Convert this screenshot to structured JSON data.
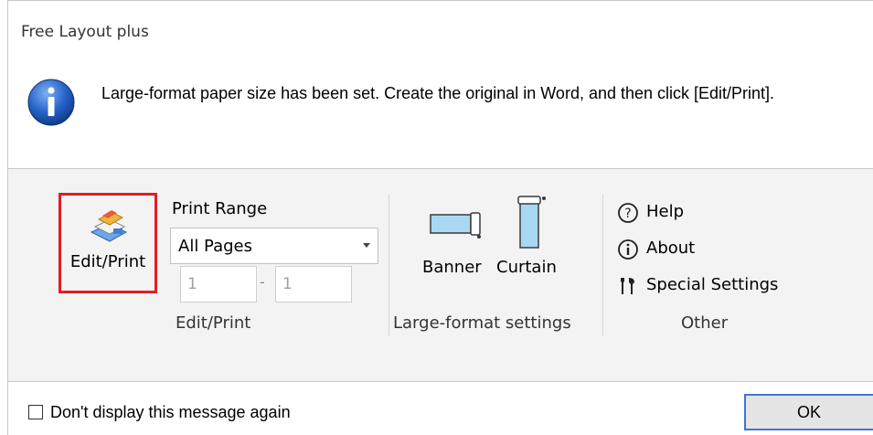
{
  "window": {
    "title": "Free Layout plus"
  },
  "message": {
    "text": "Large-format paper size has been set. Create the original in Word, and then click [Edit/Print]."
  },
  "ribbon": {
    "edit_print": {
      "button_label": "Edit/Print",
      "print_range_label": "Print Range",
      "print_range_selected": "All Pages",
      "from_page": "1",
      "range_separator": "-",
      "to_page": "1",
      "group_label": "Edit/Print"
    },
    "large_format": {
      "banner_label": "Banner",
      "curtain_label": "Curtain",
      "group_label": "Large-format settings"
    },
    "other": {
      "help_label": "Help",
      "about_label": "About",
      "special_settings_label": "Special Settings",
      "group_label": "Other"
    }
  },
  "footer": {
    "checkbox_label": "Don't display this message again",
    "checkbox_checked": false,
    "ok_label": "OK"
  },
  "colors": {
    "highlight_border": "#e31d23",
    "ok_border": "#3a78d4",
    "icon_blue": "#1f5bb5"
  }
}
